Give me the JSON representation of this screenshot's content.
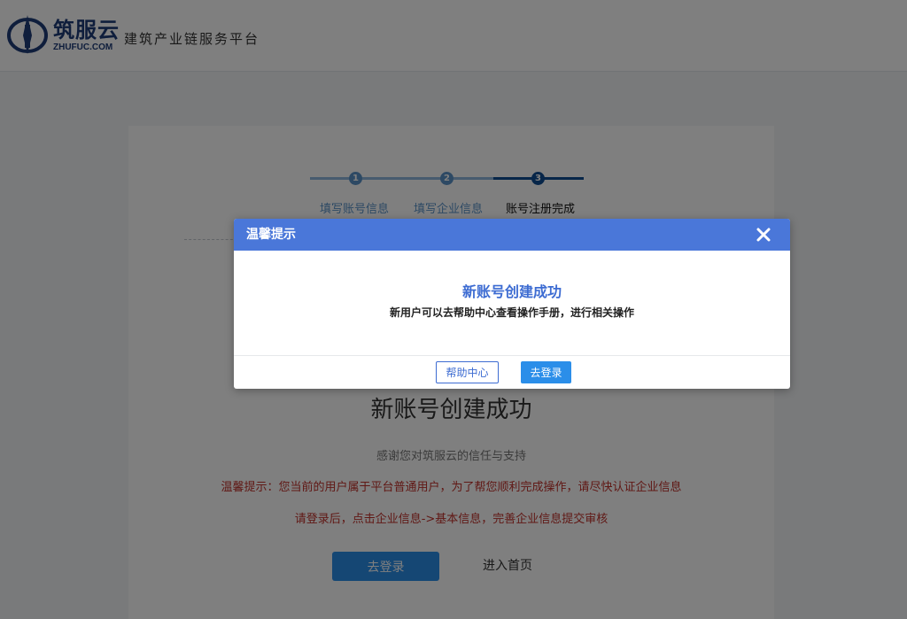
{
  "header": {
    "brand_name": "筑服云",
    "brand_domain": "ZHUFUC.COM",
    "slogan": "建筑产业链服务平台"
  },
  "steps": {
    "items": [
      {
        "number": "1",
        "label": "填写账号信息",
        "state": "done"
      },
      {
        "number": "2",
        "label": "填写企业信息",
        "state": "done"
      },
      {
        "number": "3",
        "label": "账号注册完成",
        "state": "current"
      }
    ]
  },
  "completion": {
    "title": "新账号创建成功",
    "thanks": "感谢您对筑服云的信任与支持",
    "tip1": "温馨提示：您当前的用户属于平台普通用户，为了帮您顺利完成操作，请尽快认证企业信息",
    "tip2": "请登录后，点击企业信息->基本信息，完善企业信息提交审核",
    "login_button": "去登录",
    "home_link": "进入首页"
  },
  "modal": {
    "title": "温馨提示",
    "close_icon": "close-icon",
    "heading": "新账号创建成功",
    "message": "新用户可以去帮助中心查看操作手册，进行相关操作",
    "help_button": "帮助中心",
    "login_button": "去登录"
  },
  "colors": {
    "brand": "#1f3c78",
    "primary": "#2b8ee9",
    "modal_header": "#4a77d9",
    "step_done": "#5a93c9",
    "step_current": "#0e4c92",
    "tip_red": "#c0302a"
  }
}
